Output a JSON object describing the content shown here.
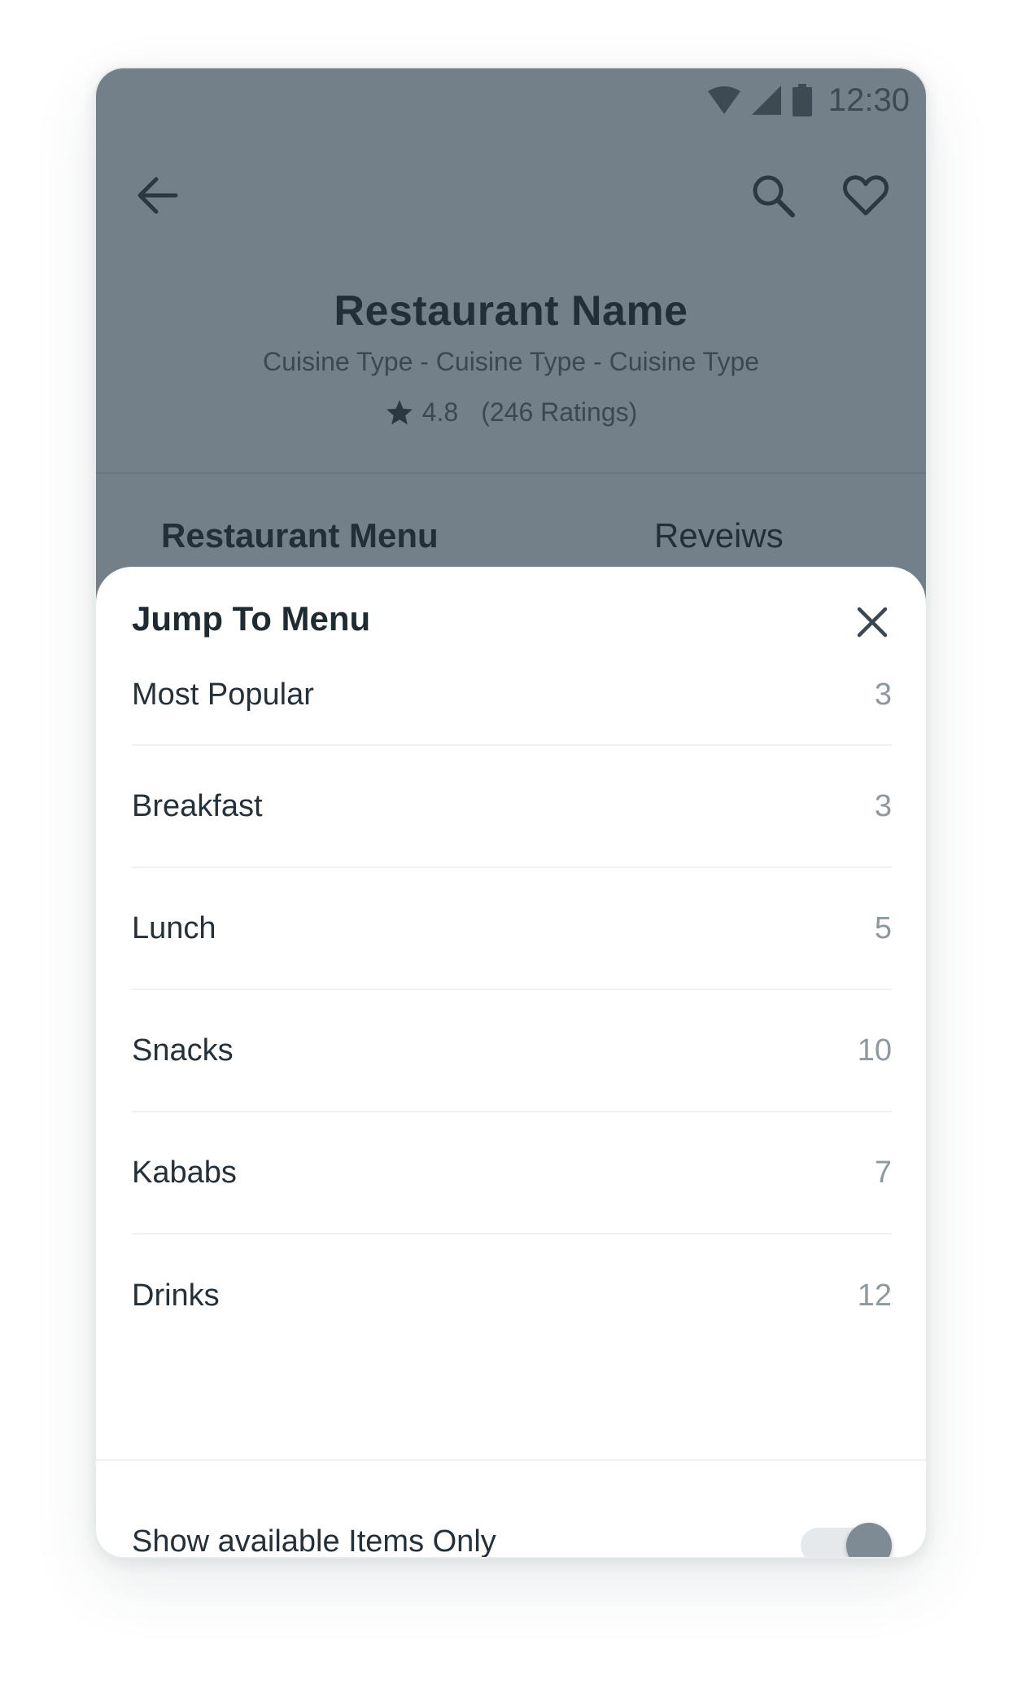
{
  "status_bar": {
    "time": "12:30"
  },
  "header": {
    "restaurant_name": "Restaurant Name",
    "cuisine": "Cuisine Type - Cuisine Type - Cuisine Type",
    "rating": "4.8",
    "ratings_count": "(246 Ratings)"
  },
  "tabs": [
    {
      "label": "Restaurant Menu"
    },
    {
      "label": "Reveiws"
    }
  ],
  "sheet": {
    "title": "Jump To Menu",
    "items": [
      {
        "label": "Most Popular",
        "count": "3"
      },
      {
        "label": "Breakfast",
        "count": "3"
      },
      {
        "label": "Lunch",
        "count": "5"
      },
      {
        "label": "Snacks",
        "count": "10"
      },
      {
        "label": "Kababs",
        "count": "7"
      },
      {
        "label": "Drinks",
        "count": "12"
      }
    ],
    "toggle_label": "Show available Items Only",
    "toggle_on": true
  },
  "colors": {
    "header_overlay": "#73808a",
    "text_dark": "#24313a",
    "text_muted": "#8d99a1",
    "toggle_knob": "#7e8b94"
  },
  "icons": [
    "wifi-icon",
    "signal-icon",
    "battery-icon",
    "back-arrow-icon",
    "search-icon",
    "heart-icon",
    "star-icon",
    "close-icon"
  ]
}
